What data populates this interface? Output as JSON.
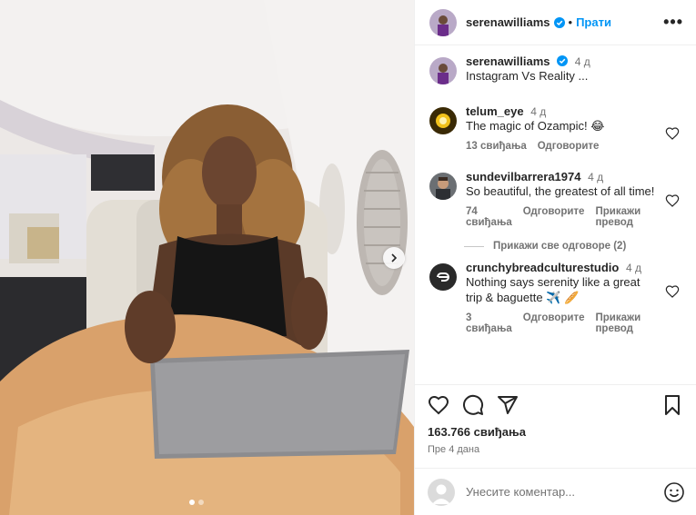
{
  "post": {
    "author": "serenawilliams",
    "follow_label": "Прати",
    "separator": "•",
    "more_label": "•••"
  },
  "caption": {
    "user": "serenawilliams",
    "time": "4 д",
    "text": "Instagram Vs Reality ..."
  },
  "comments": [
    {
      "user": "telum_eye",
      "time": "4 д",
      "text": "The magic of Ozampic! 😂",
      "likes": "13 свиђања",
      "reply": "Одговорите",
      "translate": ""
    },
    {
      "user": "sundevilbarrera1974",
      "time": "4 д",
      "text": "So beautiful, the greatest of all time!",
      "likes": "74 свиђања",
      "reply": "Одговорите",
      "translate": "Прикажи превод"
    },
    {
      "user": "crunchybreadculturestudio",
      "time": "4 д",
      "text": "Nothing says serenity like a great trip & baguette ✈️ 🥖",
      "likes": "3 свиђања",
      "reply": "Одговорите",
      "translate": "Прикажи превод"
    }
  ],
  "view_replies": "Прикажи све одговоре (2)",
  "footer": {
    "likes": "163.766 свиђања",
    "posted": "Пре 4 дана",
    "comment_placeholder": "Унесите коментар..."
  },
  "colors": {
    "accent": "#0095f6",
    "verified": "#0095f6",
    "muted": "#737373",
    "text": "#262626"
  },
  "icons": [
    "more-icon",
    "heart-icon",
    "comment-icon",
    "share-icon",
    "bookmark-icon",
    "emoji-icon",
    "chevron-right-icon",
    "verified-icon"
  ]
}
